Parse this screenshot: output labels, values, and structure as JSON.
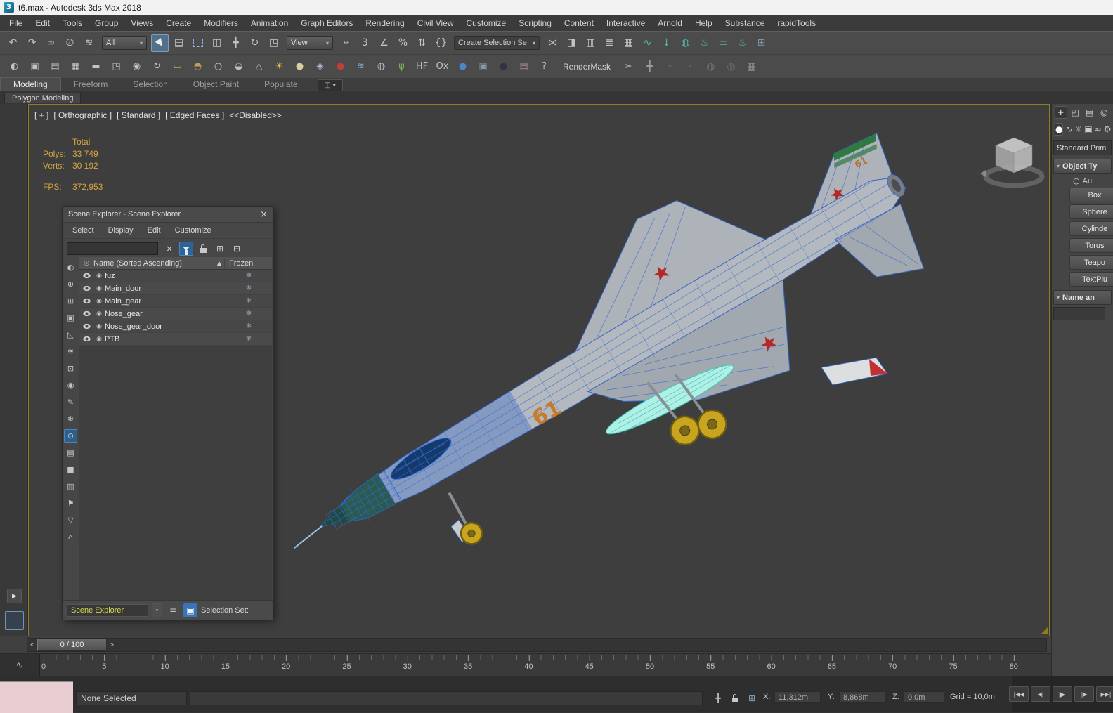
{
  "ui": {
    "dd": "▾"
  },
  "window": {
    "title": "t6.max - Autodesk 3ds Max 2018",
    "logo_glyph": "3"
  },
  "menu": {
    "items": [
      {
        "label": "File",
        "name": "menu-file"
      },
      {
        "label": "Edit",
        "name": "menu-edit"
      },
      {
        "label": "Tools",
        "name": "menu-tools"
      },
      {
        "label": "Group",
        "name": "menu-group"
      },
      {
        "label": "Views",
        "name": "menu-views"
      },
      {
        "label": "Create",
        "name": "menu-create"
      },
      {
        "label": "Modifiers",
        "name": "menu-modifiers"
      },
      {
        "label": "Animation",
        "name": "menu-animation"
      },
      {
        "label": "Graph Editors",
        "name": "menu-graph-editors"
      },
      {
        "label": "Rendering",
        "name": "menu-rendering"
      },
      {
        "label": "Civil View",
        "name": "menu-civil-view"
      },
      {
        "label": "Customize",
        "name": "menu-customize"
      },
      {
        "label": "Scripting",
        "name": "menu-scripting"
      },
      {
        "label": "Content",
        "name": "menu-content"
      },
      {
        "label": "Interactive",
        "name": "menu-interactive"
      },
      {
        "label": "Arnold",
        "name": "menu-arnold"
      },
      {
        "label": "Help",
        "name": "menu-help"
      },
      {
        "label": "Substance",
        "name": "menu-substance"
      },
      {
        "label": "rapidTools",
        "name": "menu-rapidtools"
      }
    ]
  },
  "toolbar1": {
    "segA": [
      {
        "glyph": "↶",
        "name": "undo-icon"
      },
      {
        "glyph": "↷",
        "name": "redo-icon"
      },
      {
        "glyph": "∞",
        "name": "select-and-link-icon"
      },
      {
        "glyph": "∅",
        "name": "unlink-selection-icon"
      },
      {
        "glyph": "≋",
        "name": "bind-to-spacewarp-icon"
      }
    ],
    "filter_value": "All",
    "segB": [
      {
        "cls": "i-cursor",
        "name": "select-object-icon",
        "active": true
      },
      {
        "glyph": "▤",
        "name": "select-by-name-icon"
      },
      {
        "cls": "i-dashbox",
        "name": "selection-region-icon"
      },
      {
        "glyph": "◫",
        "name": "window-crossing-icon"
      },
      {
        "glyph": "╋",
        "name": "select-and-move-icon"
      },
      {
        "glyph": "↻",
        "name": "select-and-rotate-icon"
      },
      {
        "glyph": "◳",
        "name": "select-and-scale-icon"
      }
    ],
    "view_value": "View",
    "segC": [
      {
        "glyph": "⌖",
        "name": "use-pivot-center-icon"
      },
      {
        "glyph": "3",
        "name": "snaps-toggle-icon"
      },
      {
        "glyph": "∠",
        "name": "angle-snap-icon"
      },
      {
        "glyph": "%",
        "name": "percent-snap-icon"
      },
      {
        "glyph": "⇅",
        "name": "spinner-snap-icon"
      },
      {
        "glyph": "{}",
        "name": "edit-named-selections-icon"
      }
    ],
    "selection_set_value": "Create Selection Se",
    "segD": [
      {
        "glyph": "⋈",
        "name": "mirror-icon"
      },
      {
        "glyph": "◨",
        "name": "align-icon"
      },
      {
        "glyph": "▥",
        "name": "scene-explorer-toggle-icon"
      },
      {
        "glyph": "≣",
        "name": "layer-explorer-icon"
      },
      {
        "glyph": "▦",
        "name": "ribbon-toggle-icon"
      },
      {
        "glyph": "∿",
        "name": "curve-editor-icon",
        "c": "#56b2aa"
      },
      {
        "glyph": "↧",
        "name": "schematic-view-icon",
        "c": "#56b2aa"
      },
      {
        "glyph": "◍",
        "name": "material-editor-icon",
        "c": "#56b2aa"
      },
      {
        "glyph": "♨",
        "name": "render-setup-icon",
        "c": "#56b2aa"
      },
      {
        "glyph": "▭",
        "name": "rendered-frame-window-icon",
        "c": "#56b2aa"
      },
      {
        "glyph": "♨",
        "name": "render-production-icon",
        "c": "#56b2aa"
      },
      {
        "glyph": "⊞",
        "name": "render-grid-icon",
        "c": "#7d93a5"
      }
    ]
  },
  "toolbar2": {
    "items": [
      {
        "glyph": "◐",
        "name": "asset-browser-icon"
      },
      {
        "glyph": "▣",
        "name": "viewport-canvas-icon"
      },
      {
        "glyph": "▤",
        "name": "named-views-icon"
      },
      {
        "glyph": "▦",
        "name": "grid-settings-icon"
      },
      {
        "glyph": "▬",
        "name": "keyboard-icon"
      },
      {
        "glyph": "◳",
        "name": "array-tool-icon"
      },
      {
        "glyph": "◉",
        "name": "snapshot-icon"
      },
      {
        "glyph": "↻",
        "name": "spacing-tool-icon"
      },
      {
        "glyph": "▭",
        "name": "box-tool-icon",
        "c": "#c9a34a"
      },
      {
        "glyph": "◓",
        "name": "dome-tool-icon",
        "c": "#c2a05a"
      },
      {
        "glyph": "○",
        "name": "sphere-tool-icon",
        "c": "#cfcfcf"
      },
      {
        "glyph": "◒",
        "name": "hemisphere-tool-icon",
        "c": "#bdbdbd"
      },
      {
        "glyph": "△",
        "name": "cone-tool-icon",
        "c": "#bdbdbd"
      },
      {
        "glyph": "☀",
        "name": "daylight-icon",
        "c": "#e2c23e"
      },
      {
        "glyph": "●",
        "name": "sphere2-icon",
        "c": "#d6cf9e"
      },
      {
        "glyph": "◈",
        "name": "lattice-icon",
        "c": "#a8c0d8"
      },
      {
        "glyph": "●",
        "name": "red-sphere-icon",
        "c": "#c04038"
      },
      {
        "glyph": "≋",
        "name": "water-icon",
        "c": "#7aa0c0"
      },
      {
        "glyph": "◍",
        "name": "checker-sphere-icon"
      },
      {
        "glyph": "ψ",
        "name": "foliage-icon",
        "c": "#7fae5a"
      },
      {
        "glyph": "HF",
        "name": "hair-fur-icon"
      },
      {
        "glyph": "Ox",
        "name": "ornatrix-icon"
      },
      {
        "glyph": "●",
        "name": "blue-sphere-icon",
        "c": "#4a86c8"
      },
      {
        "glyph": "▣",
        "name": "populate-tool-icon",
        "c": "#8898a8"
      },
      {
        "glyph": "●",
        "name": "dark-sphere-icon",
        "c": "#2e3440"
      },
      {
        "glyph": "▤",
        "name": "stack-icon",
        "c": "#b08898"
      },
      {
        "glyph": "?",
        "name": "help-icon"
      }
    ],
    "rendermask_label": "RenderMask",
    "tail": [
      {
        "glyph": "✂",
        "name": "scissors-icon",
        "c": "#b8b8b8"
      },
      {
        "glyph": "╋",
        "name": "move-tool2-icon",
        "c": "#9a9a9a"
      },
      {
        "glyph": "•",
        "name": "dot1-icon",
        "c": "#5e5e5e"
      },
      {
        "glyph": "•",
        "name": "dot2-icon",
        "c": "#5e5e5e"
      },
      {
        "glyph": "◍",
        "name": "soft-sphere1-icon",
        "c": "#707070"
      },
      {
        "glyph": "◍",
        "name": "soft-sphere2-icon",
        "c": "#686868"
      },
      {
        "glyph": "▦",
        "name": "grid2-icon",
        "c": "#8a8a8a"
      }
    ]
  },
  "ribbon": {
    "tabs": [
      {
        "label": "Modeling",
        "name": "ribbon-tab-modeling",
        "active": true
      },
      {
        "label": "Freeform",
        "name": "ribbon-tab-freeform"
      },
      {
        "label": "Selection",
        "name": "ribbon-tab-selection"
      },
      {
        "label": "Object Paint",
        "name": "ribbon-tab-object-paint"
      },
      {
        "label": "Populate",
        "name": "ribbon-tab-populate"
      }
    ],
    "config_glyph": "◫",
    "subtab": "Polygon Modeling"
  },
  "viewport": {
    "label_segments": [
      {
        "label": "[ + ]",
        "name": "viewport-menu-general"
      },
      {
        "label": "[ Orthographic ]",
        "name": "viewport-menu-pov"
      },
      {
        "label": "[ Standard ]",
        "name": "viewport-menu-style"
      },
      {
        "label": "[ Edged Faces ]",
        "name": "viewport-menu-shading"
      },
      {
        "label": "<<Disabled>>",
        "name": "viewport-disabled-flag"
      }
    ],
    "stats": {
      "total_label": "Total",
      "polys_label": "Polys:",
      "polys_value": "33 749",
      "verts_label": "Verts:",
      "verts_value": "30 192",
      "fps_label": "FPS:",
      "fps_value": "372,953"
    },
    "marking": "61"
  },
  "scene_explorer": {
    "title": "Scene Explorer - Scene Explorer",
    "close_glyph": "×",
    "menu": [
      {
        "label": "Select",
        "name": "se-menu-select"
      },
      {
        "label": "Display",
        "name": "se-menu-display"
      },
      {
        "label": "Edit",
        "name": "se-menu-edit"
      },
      {
        "label": "Customize",
        "name": "se-menu-customize"
      }
    ],
    "toolbar": [
      {
        "glyph": "×",
        "name": "se-clear-search-icon"
      },
      {
        "cls": "i-funnel",
        "name": "se-filter-icon",
        "active": true
      },
      {
        "cls": "i-lock",
        "name": "se-lock-icon"
      },
      {
        "glyph": "⊞",
        "name": "se-expand-all-icon"
      },
      {
        "glyph": "⊟",
        "name": "se-collapse-all-icon"
      }
    ],
    "columns": {
      "icon_glyph": "◎",
      "name": "Name (Sorted Ascending)",
      "sort_glyph": "▲",
      "frozen": "Frozen"
    },
    "dot_glyph": "◉",
    "frozen_glyph": "❄",
    "rows": [
      {
        "name": "fuz"
      },
      {
        "name": "Main_door"
      },
      {
        "name": "Main_gear"
      },
      {
        "name": "Nose_gear"
      },
      {
        "name": "Nose_gear_door"
      },
      {
        "name": "PTB"
      }
    ],
    "strip": [
      {
        "glyph": "◐",
        "name": "se-display-all-icon"
      },
      {
        "glyph": "⊕",
        "name": "se-display-geometry-icon"
      },
      {
        "glyph": "⊞",
        "name": "se-display-shapes-icon"
      },
      {
        "glyph": "▣",
        "name": "se-display-lights-icon"
      },
      {
        "glyph": "◺",
        "name": "se-display-cameras-icon"
      },
      {
        "glyph": "≋",
        "name": "se-display-helpers-icon"
      },
      {
        "glyph": "⊡",
        "name": "se-display-spacewarps-icon"
      },
      {
        "glyph": "◉",
        "name": "se-display-groups-icon"
      },
      {
        "glyph": "✎",
        "name": "se-display-xrefs-icon"
      },
      {
        "glyph": "❄",
        "name": "se-display-frozen-icon"
      },
      {
        "glyph": "⊙",
        "name": "se-display-hidden-icon",
        "active": true
      },
      {
        "glyph": "▤",
        "name": "se-display-materials-icon"
      },
      {
        "glyph": "■",
        "name": "se-display-bones-icon"
      },
      {
        "glyph": "▥",
        "name": "se-display-containers-icon"
      },
      {
        "glyph": "⚑",
        "name": "se-display-flags-icon"
      },
      {
        "glyph": "▽",
        "name": "se-display-particles-icon"
      },
      {
        "glyph": "⌂",
        "name": "se-display-roots-icon"
      }
    ],
    "footer": {
      "explorer_name": "Scene Explorer",
      "layers_glyph": "≣",
      "set_glyph": "▣",
      "selection_set_label": "Selection Set:"
    }
  },
  "command_panel": {
    "tabs": [
      {
        "glyph": "+",
        "name": "create-tab-icon",
        "active": true
      },
      {
        "glyph": "◰",
        "name": "modify-tab-icon"
      },
      {
        "glyph": "▤",
        "name": "hierarchy-tab-icon"
      },
      {
        "glyph": "◎",
        "name": "motion-tab-icon"
      }
    ],
    "categories": [
      {
        "glyph": "●",
        "name": "geometry-category-icon",
        "active": true
      },
      {
        "glyph": "∿",
        "name": "shapes-category-icon"
      },
      {
        "glyph": "☼",
        "name": "lights-category-icon"
      },
      {
        "glyph": "▣",
        "name": "cameras-category-icon"
      },
      {
        "glyph": "≈",
        "name": "spacewarps-category-icon"
      },
      {
        "glyph": "⚙",
        "name": "systems-category-icon"
      }
    ],
    "category_value": "Standard Prim",
    "rollout_arrow": "▾",
    "object_type_rollout": "Object Ty",
    "autogrid_box": "○",
    "autogrid_label": "Au",
    "buttons": [
      {
        "label": "Box",
        "name": "create-box-button"
      },
      {
        "label": "Sphere",
        "name": "create-sphere-button"
      },
      {
        "label": "Cylinde",
        "name": "create-cylinder-button"
      },
      {
        "label": "Torus",
        "name": "create-torus-button"
      },
      {
        "label": "Teapo",
        "name": "create-teapot-button"
      },
      {
        "label": "TextPlu",
        "name": "create-textplus-button"
      }
    ],
    "name_color_rollout": "Name an"
  },
  "timeline": {
    "prev_glyph": "<",
    "slider_label": "0 / 100",
    "next_glyph": ">",
    "curve_icon_glyph": "∿"
  },
  "ruler": {
    "ticks": [
      {
        "label": "0"
      },
      {
        "label": "5"
      },
      {
        "label": "10"
      },
      {
        "label": "15"
      },
      {
        "label": "20"
      },
      {
        "label": "25"
      },
      {
        "label": "30"
      },
      {
        "label": "35"
      },
      {
        "label": "40"
      },
      {
        "label": "45"
      },
      {
        "label": "50"
      },
      {
        "label": "55"
      },
      {
        "label": "60"
      },
      {
        "label": "65"
      },
      {
        "label": "70"
      },
      {
        "label": "75"
      },
      {
        "label": "80"
      }
    ]
  },
  "status": {
    "none_selected": "None Selected",
    "icons": [
      {
        "glyph": "╋",
        "name": "transform-gizmo-toggle-icon"
      },
      {
        "cls": "i-lock",
        "name": "selection-lock-icon"
      },
      {
        "glyph": "⊞",
        "name": "absolute-mode-icon",
        "c": "#7fa8c8"
      }
    ],
    "x_label": "X:",
    "x_value": "11,312m",
    "y_label": "Y:",
    "y_value": "8,868m",
    "z_label": "Z:",
    "z_value": "0,0m",
    "grid_label": "Grid = 10,0m",
    "playback": [
      {
        "glyph": "|◀◀",
        "name": "go-to-start-button"
      },
      {
        "glyph": "◀|",
        "name": "previous-frame-button"
      },
      {
        "glyph": "▶",
        "name": "play-button",
        "cls": "play"
      },
      {
        "glyph": "|▶",
        "name": "next-frame-button"
      },
      {
        "glyph": "▶▶|",
        "name": "go-to-end-button"
      }
    ]
  },
  "rail": {
    "arrow_glyph": "▶"
  }
}
